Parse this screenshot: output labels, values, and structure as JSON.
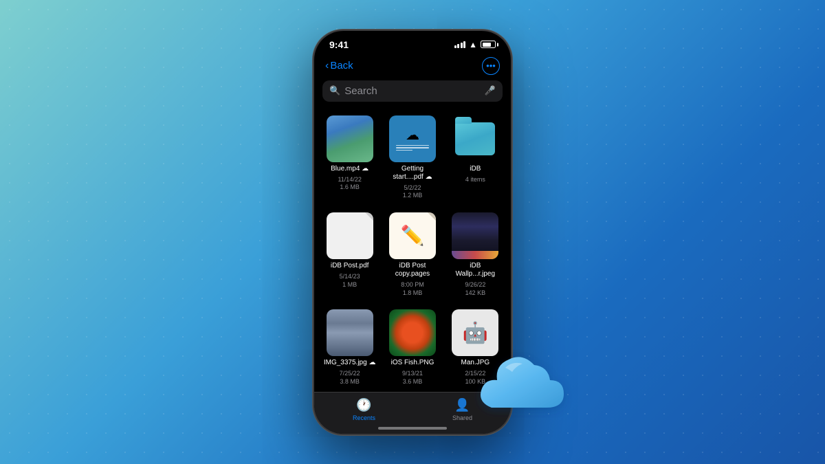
{
  "background": {
    "gradient_start": "#7ecfcf",
    "gradient_end": "#1855a8"
  },
  "status_bar": {
    "time": "9:41",
    "signal": "full",
    "wifi": true,
    "battery": "75%"
  },
  "nav": {
    "back_label": "Back",
    "more_icon": "ellipsis"
  },
  "search": {
    "placeholder": "Search",
    "mic_icon": "mic-icon",
    "glass_icon": "search-icon"
  },
  "files": [
    {
      "name": "Blue.mp4",
      "meta_line1": "11/14/22",
      "meta_line2": "1.6 MB",
      "type": "video",
      "cloud": true
    },
    {
      "name": "Getting start....pdf",
      "meta_line1": "5/2/22",
      "meta_line2": "1.2 MB",
      "type": "doc-blue",
      "cloud": true
    },
    {
      "name": "iDB",
      "meta_line1": "4 items",
      "meta_line2": "",
      "type": "folder",
      "cloud": false
    },
    {
      "name": "iDB Post.pdf",
      "meta_line1": "5/14/23",
      "meta_line2": "1 MB",
      "type": "pdf",
      "cloud": false
    },
    {
      "name": "iDB Post copy.pages",
      "meta_line1": "8:00 PM",
      "meta_line2": "1.8 MB",
      "type": "pages",
      "cloud": false
    },
    {
      "name": "iDB Wallp...r.jpeg",
      "meta_line1": "9/26/22",
      "meta_line2": "142 KB",
      "type": "wallpaper",
      "cloud": false
    },
    {
      "name": "IMG_3375.jpg",
      "meta_line1": "7/25/22",
      "meta_line2": "3.8 MB",
      "type": "curtain",
      "cloud": true
    },
    {
      "name": "iOS Fish.PNG",
      "meta_line1": "9/13/21",
      "meta_line2": "3.6 MB",
      "type": "fish",
      "cloud": false
    },
    {
      "name": "Man.JPG",
      "meta_line1": "2/15/22",
      "meta_line2": "100 KB",
      "type": "man",
      "cloud": false
    }
  ],
  "tabs": [
    {
      "label": "Recents",
      "icon": "clock-icon",
      "active": true
    },
    {
      "label": "Shared",
      "icon": "shared-icon",
      "active": false
    }
  ]
}
